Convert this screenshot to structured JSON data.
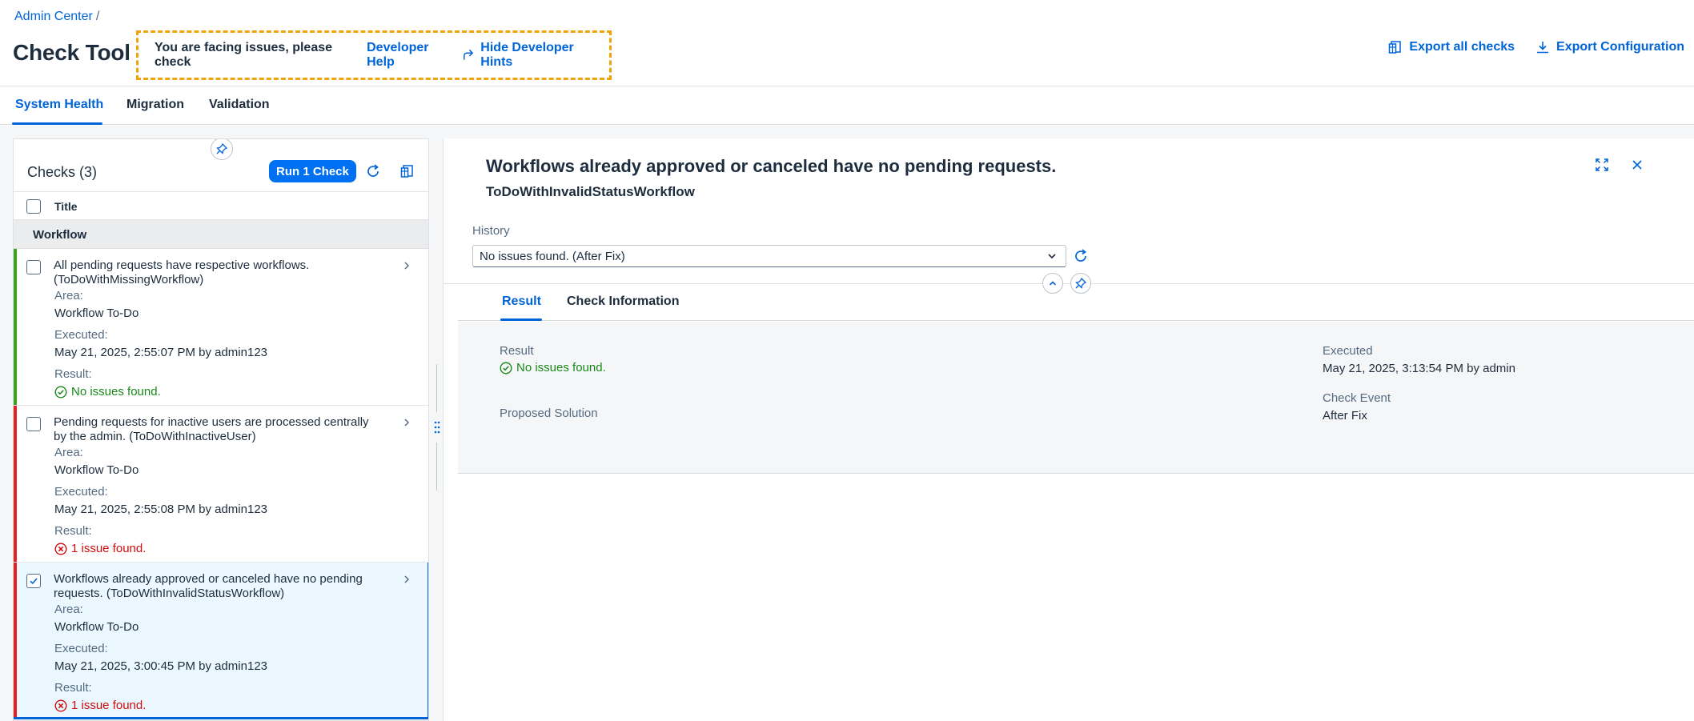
{
  "header": {
    "breadcrumb": "Admin Center",
    "breadcrumb_sep": "/",
    "title": "Check Tool",
    "hint_text": "You are facing issues, please check",
    "developer_help": "Developer Help",
    "hide_hints": "Hide Developer Hints",
    "export_all": "Export all checks",
    "export_config": "Export Configuration"
  },
  "tabs": [
    {
      "label": "System Health"
    },
    {
      "label": "Migration"
    },
    {
      "label": "Validation"
    }
  ],
  "checks": {
    "title": "Checks (3)",
    "run_button": "Run 1 Check",
    "col_title": "Title",
    "group": "Workflow",
    "area_label": "Area:",
    "executed_label": "Executed:",
    "result_label": "Result:",
    "items": [
      {
        "title": "All pending requests have respective workflows. (ToDoWithMissingWorkflow)",
        "area": "Workflow To-Do",
        "executed": "May 21, 2025, 2:55:07 PM by admin123",
        "result": "No issues found."
      },
      {
        "title": "Pending requests for inactive users are processed centrally by the admin. (ToDoWithInactiveUser)",
        "area": "Workflow To-Do",
        "executed": "May 21, 2025, 2:55:08 PM by admin123",
        "result": "1 issue found."
      },
      {
        "title": "Workflows already approved or canceled have no pending requests. (ToDoWithInvalidStatusWorkflow)",
        "area": "Workflow To-Do",
        "executed": "May 21, 2025, 3:00:45 PM by admin123",
        "result": "1 issue found."
      }
    ]
  },
  "detail": {
    "title": "Workflows already approved or canceled have no pending requests.",
    "subtitle": "ToDoWithInvalidStatusWorkflow",
    "history_label": "History",
    "history_value": "No issues found. (After Fix)",
    "tabs": [
      {
        "label": "Result"
      },
      {
        "label": "Check Information"
      }
    ],
    "result_label": "Result",
    "result_value": "No issues found.",
    "proposed_label": "Proposed Solution",
    "executed_label": "Executed",
    "executed_value": "May 21, 2025, 3:13:54 PM by admin",
    "event_label": "Check Event",
    "event_value": "After Fix"
  },
  "colors": {
    "accent": "#0064d9",
    "success": "#188918",
    "error": "#d20a0a",
    "hint_border": "#f0a30a"
  }
}
